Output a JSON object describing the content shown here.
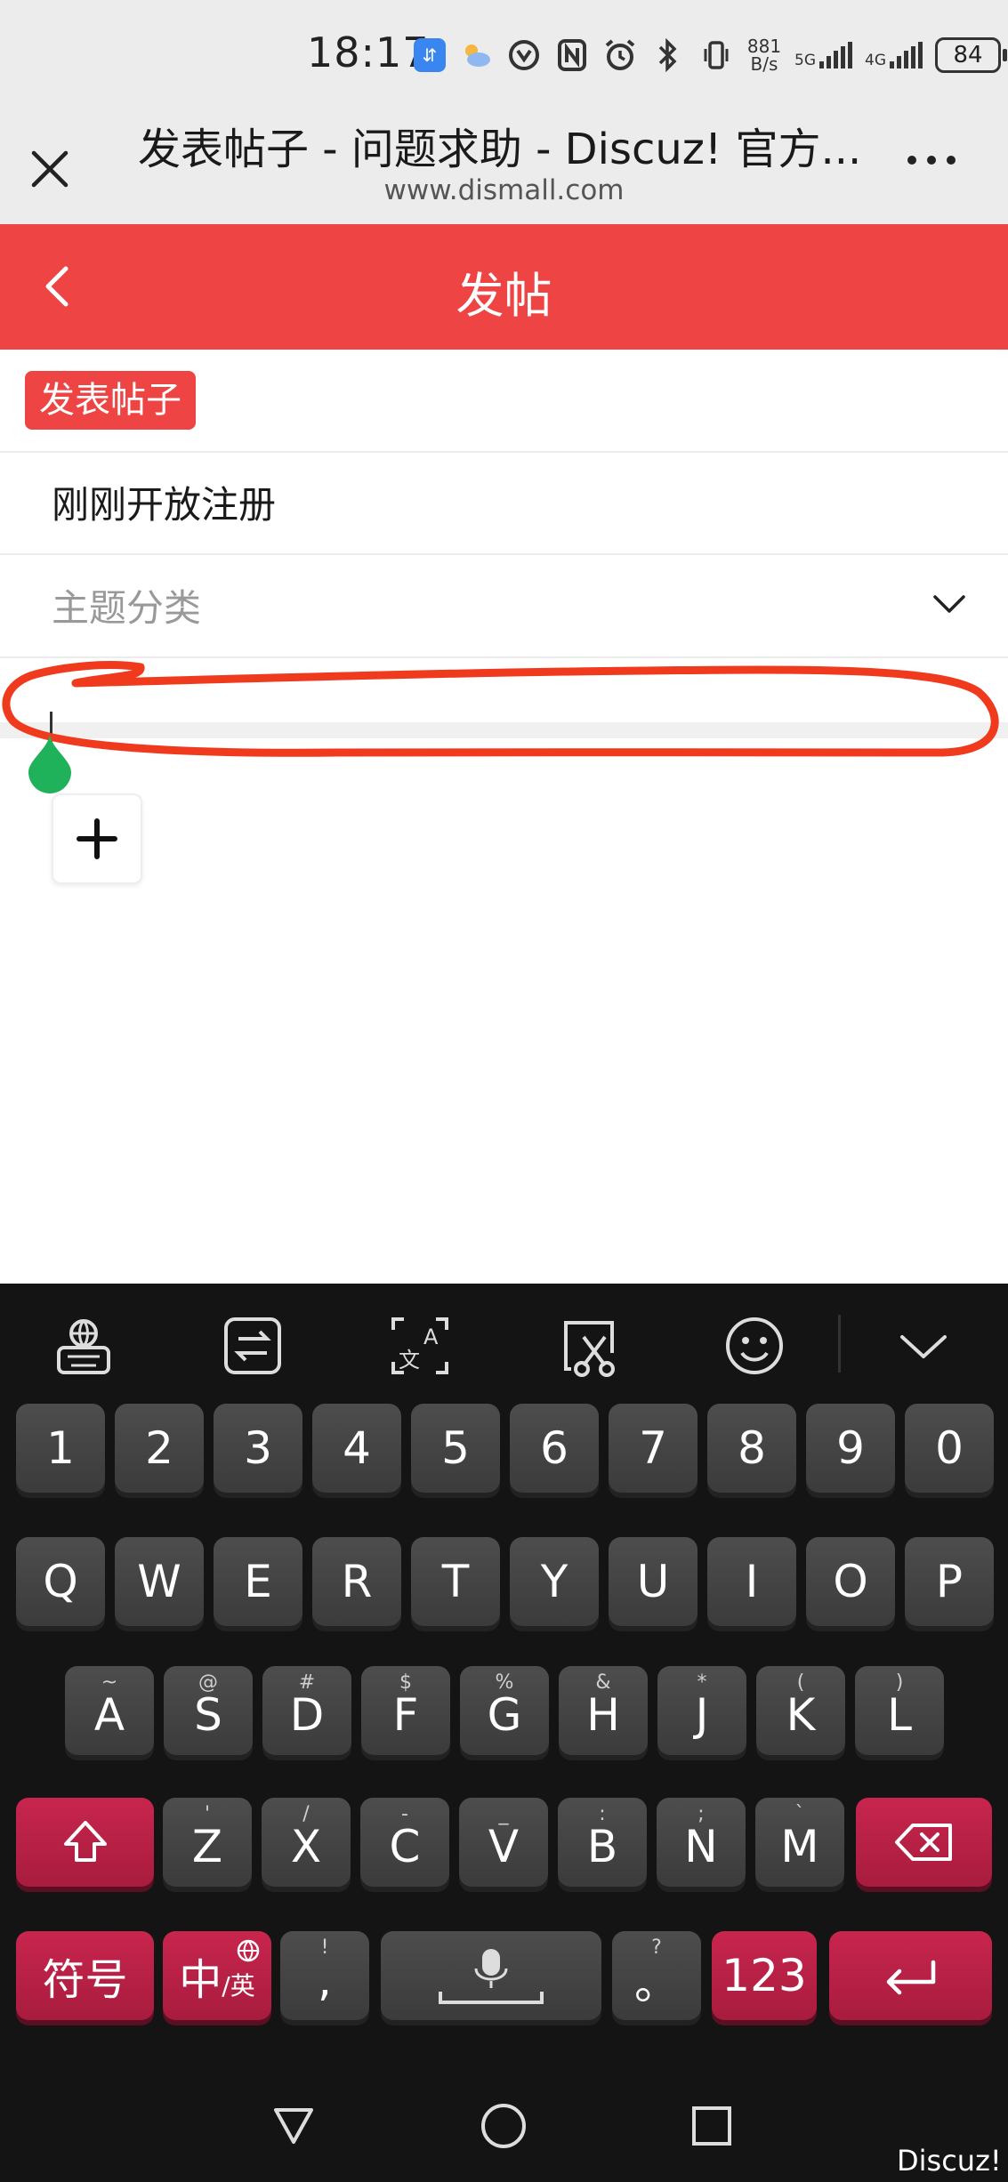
{
  "status_bar": {
    "time": "18:17",
    "net_speed_value": "881",
    "net_speed_unit": "B/s",
    "sig1_label": "5G",
    "sig2_label": "4G",
    "battery": "84"
  },
  "browser": {
    "title": "发表帖子 - 问题求助 - Discuz! 官方...",
    "url": "www.dismall.com"
  },
  "header": {
    "title": "发帖"
  },
  "form": {
    "tag_label": "发表帖子",
    "subject_value": "刚刚开放注册",
    "category_placeholder": "主题分类"
  },
  "keyboard": {
    "row_numbers": [
      "1",
      "2",
      "3",
      "4",
      "5",
      "6",
      "7",
      "8",
      "9",
      "0"
    ],
    "row_qwerty": [
      "Q",
      "W",
      "E",
      "R",
      "T",
      "Y",
      "U",
      "I",
      "O",
      "P"
    ],
    "row_asdf": [
      {
        "main": "A",
        "sub": "~"
      },
      {
        "main": "S",
        "sub": "@"
      },
      {
        "main": "D",
        "sub": "#"
      },
      {
        "main": "F",
        "sub": "$"
      },
      {
        "main": "G",
        "sub": "%"
      },
      {
        "main": "H",
        "sub": "&"
      },
      {
        "main": "J",
        "sub": "*"
      },
      {
        "main": "K",
        "sub": "("
      },
      {
        "main": "L",
        "sub": ")"
      }
    ],
    "row_zxcv": [
      {
        "main": "Z",
        "sub": "'"
      },
      {
        "main": "X",
        "sub": "/"
      },
      {
        "main": "C",
        "sub": "-"
      },
      {
        "main": "V",
        "sub": "_"
      },
      {
        "main": "B",
        "sub": ":"
      },
      {
        "main": "N",
        "sub": ";"
      },
      {
        "main": "M",
        "sub": "`"
      }
    ],
    "symbols_label": "符号",
    "lang_label_main": "中",
    "lang_label_sub": "/英",
    "comma_main": ",",
    "comma_sub": "!",
    "period_main": "。",
    "period_sub": "?",
    "num_label": "123"
  },
  "watermark": "Discuz!",
  "colors": {
    "accent": "#ef4444",
    "key_red": "#b8204a",
    "key_dark": "#444444"
  }
}
